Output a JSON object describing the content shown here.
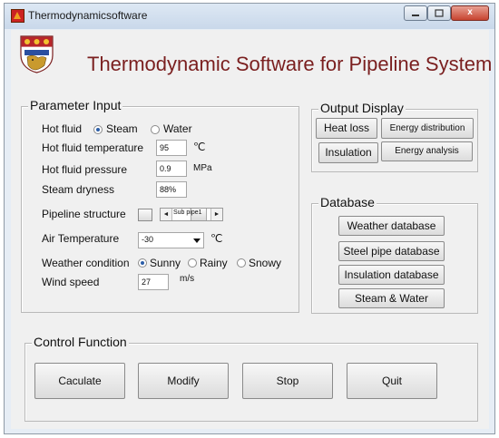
{
  "window": {
    "title": "Thermodynamicsoftware",
    "close_glyph": "x"
  },
  "header": {
    "title": "Thermodynamic Software for Pipeline System"
  },
  "parameter_input": {
    "title": "Parameter Input",
    "hot_fluid": {
      "label": "Hot fluid",
      "options": [
        "Steam",
        "Water"
      ],
      "selected": "Steam"
    },
    "hot_fluid_temperature": {
      "label": "Hot fluid temperature",
      "value": "95",
      "unit": "℃"
    },
    "hot_fluid_pressure": {
      "label": "Hot fluid pressure",
      "value": "0.9",
      "unit": "MPa"
    },
    "steam_dryness": {
      "label": "Steam dryness",
      "value": "88%"
    },
    "pipeline_structure": {
      "label": "Pipeline structure",
      "slider_label": "Sub pipe1"
    },
    "air_temperature": {
      "label": "Air Temperature",
      "value": "-30",
      "unit": "℃"
    },
    "weather_condition": {
      "label": "Weather condition",
      "options": [
        "Sunny",
        "Rainy",
        "Snowy"
      ],
      "selected": "Sunny"
    },
    "wind_speed": {
      "label": "Wind speed",
      "value": "27",
      "unit": "m/s"
    }
  },
  "output_display": {
    "title": "Output Display",
    "buttons": [
      "Heat loss",
      "Energy distribution",
      "Insulation",
      "Energy analysis"
    ]
  },
  "database": {
    "title": "Database",
    "buttons": [
      "Weather database",
      "Steel pipe database",
      "Insulation database",
      "Steam & Water"
    ]
  },
  "control_function": {
    "title": "Control Function",
    "buttons": [
      "Caculate",
      "Modify",
      "Stop",
      "Quit"
    ]
  },
  "colors": {
    "header_title": "#7a1f1f",
    "radio_selected": "#2c5ea8",
    "close_button": "#c7432f"
  }
}
